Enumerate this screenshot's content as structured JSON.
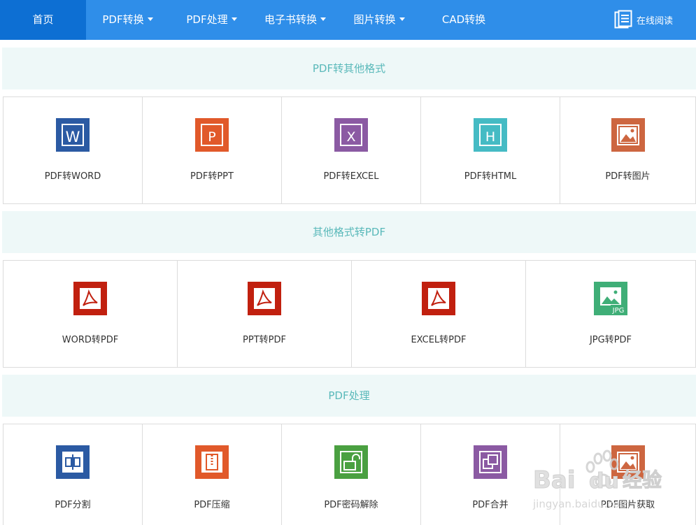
{
  "nav": {
    "items": [
      {
        "label": "首页"
      },
      {
        "label": "PDF转换"
      },
      {
        "label": "PDF处理"
      },
      {
        "label": "电子书转换"
      },
      {
        "label": "图片转换"
      },
      {
        "label": "CAD转换"
      }
    ],
    "online_read": "在线阅读"
  },
  "sections": [
    {
      "title": "PDF转其他格式",
      "items": [
        {
          "label": "PDF转WORD",
          "icon": "word-icon",
          "color": "#2b5aa3"
        },
        {
          "label": "PDF转PPT",
          "icon": "ppt-icon",
          "color": "#e1592a"
        },
        {
          "label": "PDF转EXCEL",
          "icon": "excel-icon",
          "color": "#8b5aa3"
        },
        {
          "label": "PDF转HTML",
          "icon": "html-icon",
          "color": "#45bbc4"
        },
        {
          "label": "PDF转图片",
          "icon": "image-icon",
          "color": "#cd6640"
        }
      ]
    },
    {
      "title": "其他格式转PDF",
      "items": [
        {
          "label": "WORD转PDF",
          "icon": "pdf-icon",
          "color": "#c1200f"
        },
        {
          "label": "PPT转PDF",
          "icon": "pdf-icon",
          "color": "#c1200f"
        },
        {
          "label": "EXCEL转PDF",
          "icon": "pdf-icon",
          "color": "#c1200f"
        },
        {
          "label": "JPG转PDF",
          "icon": "jpg-icon",
          "color": "#3fae77"
        }
      ]
    },
    {
      "title": "PDF处理",
      "items": [
        {
          "label": "PDF分割",
          "icon": "split-icon",
          "color": "#2b5aa3"
        },
        {
          "label": "PDF压缩",
          "icon": "compress-icon",
          "color": "#e1592a"
        },
        {
          "label": "PDF密码解除",
          "icon": "unlock-icon",
          "color": "#4aa041"
        },
        {
          "label": "PDF合并",
          "icon": "merge-icon",
          "color": "#8b5aa3"
        },
        {
          "label": "PDF图片获取",
          "icon": "image-icon",
          "color": "#cd6640"
        }
      ]
    }
  ],
  "watermark": {
    "brand": "Baidu经验",
    "url": "jingyan.baidu.com"
  }
}
